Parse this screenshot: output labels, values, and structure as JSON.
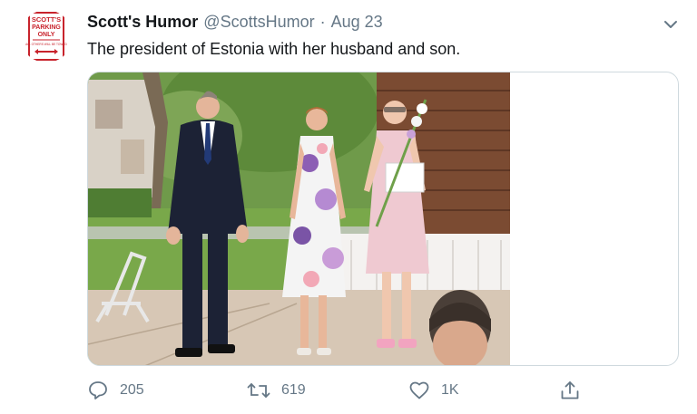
{
  "author": {
    "display_name": "Scott's Humor",
    "handle": "@ScottsHumor",
    "separator": "·",
    "date": "Aug 23"
  },
  "avatar": {
    "sign_lines": [
      "SCOTT'S",
      "PARKING",
      "ONLY"
    ],
    "sign_small": "ALL OTHERS WILL BE TOWED",
    "colors": {
      "red": "#c8232c",
      "white": "#ffffff"
    }
  },
  "tweet": {
    "text": "The president of Estonia with her husband and son."
  },
  "actions": {
    "reply_count": "205",
    "retweet_count": "619",
    "like_count": "1K"
  },
  "icons": {
    "caret": "chevron-down-icon",
    "reply": "speech-bubble-icon",
    "retweet": "retweet-icon",
    "like": "heart-icon",
    "share": "share-upload-icon"
  },
  "colors": {
    "text": "#14171a",
    "secondary": "#657786",
    "border": "#cfd9de"
  }
}
